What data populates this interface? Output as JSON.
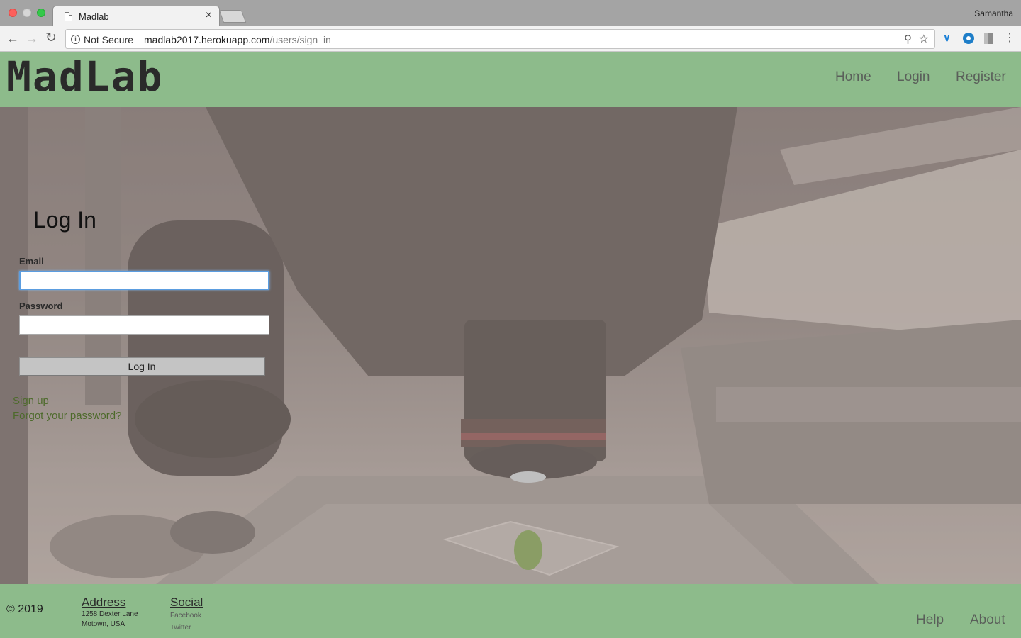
{
  "browser": {
    "tab_title": "Madlab",
    "tab_close": "×",
    "profile_name": "Samantha",
    "security_label": "Not Secure",
    "url_host": "madlab2017.herokuapp.com",
    "url_path": "/users/sign_in",
    "icons": [
      "back-icon",
      "forward-icon",
      "reload-icon",
      "info-icon",
      "zoom-icon",
      "star-icon",
      "extension-icons",
      "menu-icon"
    ]
  },
  "header": {
    "logo": "MadLab",
    "nav": [
      {
        "label": "Home"
      },
      {
        "label": "Login"
      },
      {
        "label": "Register"
      }
    ]
  },
  "login": {
    "title": "Log In",
    "email_label": "Email",
    "email_value": "",
    "password_label": "Password",
    "password_value": "",
    "submit_label": "Log In",
    "signup_link": "Sign up",
    "forgot_link": "Forgot your password?"
  },
  "footer": {
    "copyright": "© 2019",
    "address_heading": "Address",
    "address_line1": "1258 Dexter Lane",
    "address_line2": "Motown, USA",
    "social_heading": "Social",
    "social_links": [
      "Facebook",
      "Twitter"
    ],
    "links": [
      "Help",
      "About"
    ]
  },
  "colors": {
    "header_bg": "#8dbb8b",
    "footer_bg": "#8dbb8b",
    "link_green": "#4d6a2b",
    "focus_blue": "#5b9de0"
  }
}
